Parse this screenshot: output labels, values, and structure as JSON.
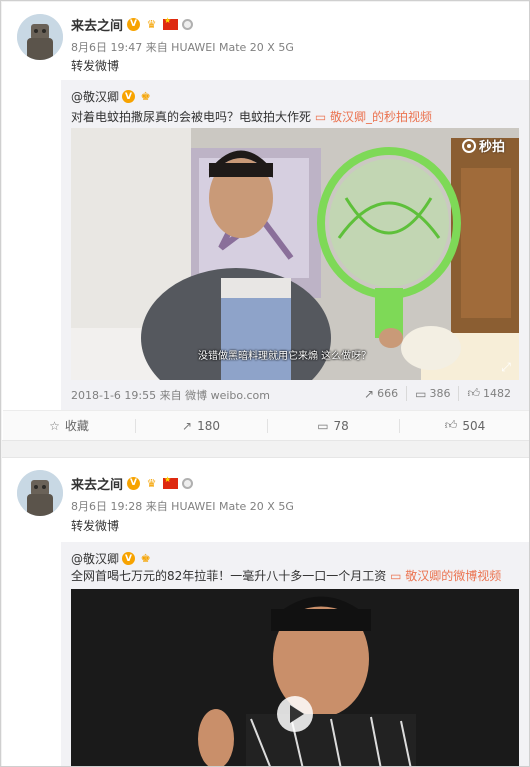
{
  "posts": [
    {
      "user": {
        "name": "来去之间",
        "badge": "V"
      },
      "meta": "8月6日 19:47 来自 HUAWEI Mate 20 X 5G",
      "text": "转发微博",
      "repost": {
        "author": "@敬汉卿",
        "badge": "V",
        "text": "对着电蚊拍撒尿真的会被电吗？电蚊拍大作死",
        "link": "敬汉卿_的秒拍视频",
        "video_watermark": "秒拍",
        "subtitle": "没错做黑暗料理就用它来煽 这么做呀？",
        "footer_time": "2018-1-6 19:55 来自 微博 weibo.com",
        "shares": "666",
        "comments": "386",
        "likes": "1482"
      },
      "actions": {
        "favorite": "收藏",
        "forward": "180",
        "comment": "78",
        "like": "504"
      }
    },
    {
      "user": {
        "name": "来去之间",
        "badge": "V"
      },
      "meta": "8月6日 19:28 来自 HUAWEI Mate 20 X 5G",
      "text": "转发微博",
      "repost": {
        "author": "@敬汉卿",
        "badge": "V",
        "text": "全网首喝七万元的82年拉菲！一毫升八十多一口一个月工资",
        "link": "敬汉卿的微博视频"
      }
    }
  ],
  "colors": {
    "link": "#eb7350",
    "badge": "#f7a300",
    "repost_bg": "#f2f2f5"
  }
}
